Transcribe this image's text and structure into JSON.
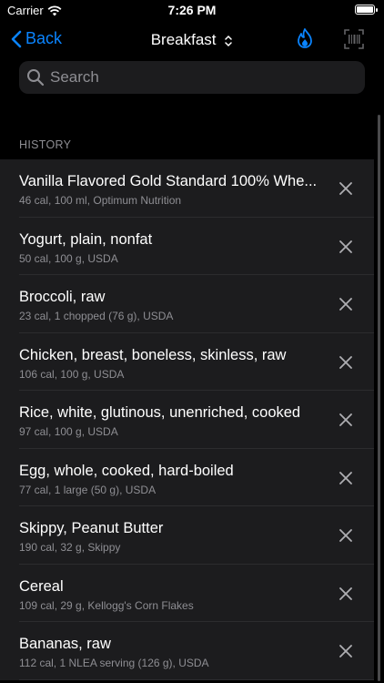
{
  "status": {
    "carrier": "Carrier",
    "time": "7:26 PM"
  },
  "nav": {
    "back_label": "Back",
    "title": "Breakfast"
  },
  "search": {
    "placeholder": "Search"
  },
  "history": {
    "header": "HISTORY",
    "items": [
      {
        "title": "Vanilla Flavored Gold Standard 100% Whe...",
        "subtitle": "46 cal, 100 ml, Optimum Nutrition"
      },
      {
        "title": "Yogurt, plain, nonfat",
        "subtitle": "50 cal, 100 g, USDA"
      },
      {
        "title": "Broccoli, raw",
        "subtitle": "23 cal, 1 chopped (76 g), USDA"
      },
      {
        "title": "Chicken, breast, boneless, skinless, raw",
        "subtitle": "106 cal, 100 g, USDA"
      },
      {
        "title": "Rice, white, glutinous, unenriched, cooked",
        "subtitle": "97 cal, 100 g, USDA"
      },
      {
        "title": "Egg, whole, cooked, hard-boiled",
        "subtitle": "77 cal, 1 large (50 g), USDA"
      },
      {
        "title": "Skippy, Peanut Butter",
        "subtitle": "190 cal, 32 g, Skippy"
      },
      {
        "title": "Cereal",
        "subtitle": "109 cal, 29 g, Kellogg's Corn Flakes"
      },
      {
        "title": "Bananas, raw",
        "subtitle": "112 cal, 1 NLEA serving (126 g), USDA"
      }
    ]
  },
  "colors": {
    "accent": "#0a84ff",
    "background": "#000000",
    "cell": "#1c1c1e",
    "secondary_text": "#8e8e93"
  }
}
